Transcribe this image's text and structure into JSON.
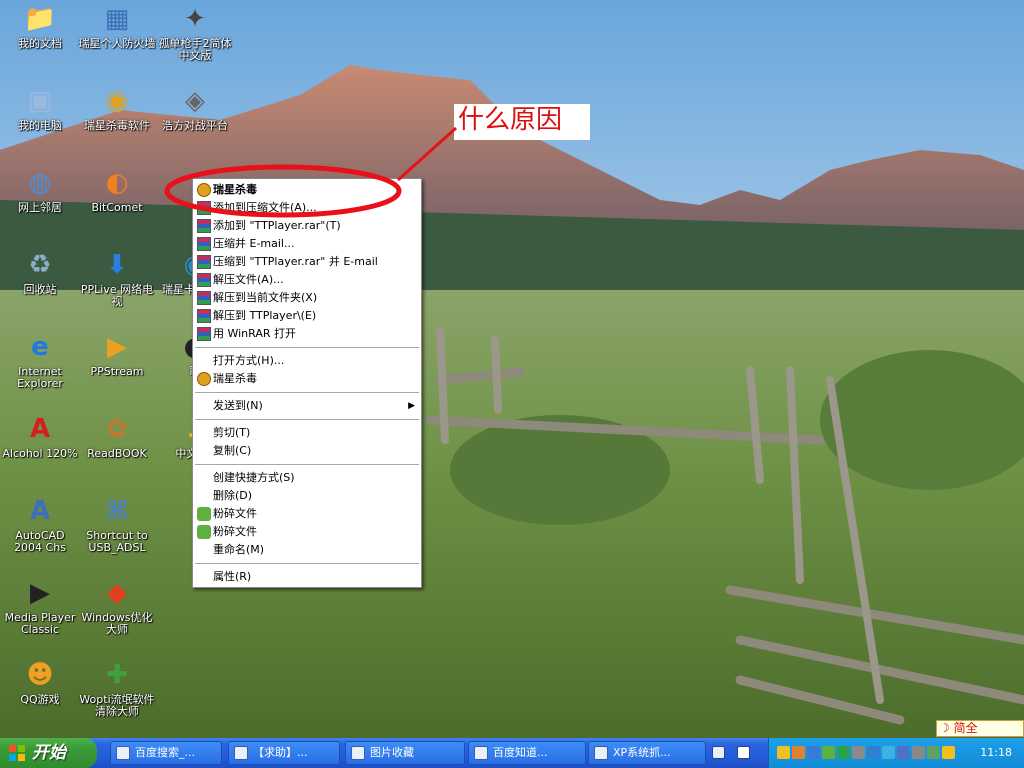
{
  "desktop": {
    "icons": [
      {
        "label": "我的文档",
        "icon": "folder-documents-icon"
      },
      {
        "label": "瑞星个人防火墙",
        "icon": "firewall-icon"
      },
      {
        "label": "孤单枪手2简体中文版",
        "icon": "game-gun-icon"
      },
      {
        "label": "我的电脑",
        "icon": "my-computer-icon"
      },
      {
        "label": "瑞星杀毒软件",
        "icon": "rising-antivirus-icon"
      },
      {
        "label": "浩方对战平台",
        "icon": "game-platform-icon"
      },
      {
        "label": "网上邻居",
        "icon": "network-icon"
      },
      {
        "label": "BitComet",
        "icon": "bitcomet-icon"
      },
      {
        "label": "回收站",
        "icon": "recycle-bin-icon"
      },
      {
        "label": "PPLive 网络电视",
        "icon": "pplive-icon"
      },
      {
        "label": "瑞星卡卡安全",
        "icon": "rising-kaka-icon"
      },
      {
        "label": "Internet Explorer",
        "icon": "internet-explorer-icon"
      },
      {
        "label": "PPStream",
        "icon": "ppstream-icon"
      },
      {
        "label": "聊",
        "icon": "qq-penguin-icon"
      },
      {
        "label": "Alcohol 120%",
        "icon": "alcohol-icon"
      },
      {
        "label": "ReadBOOK",
        "icon": "readbook-icon"
      },
      {
        "label": "中文F歌",
        "icon": "music-icon"
      },
      {
        "label": "AutoCAD 2004 Chs",
        "icon": "autocad-icon"
      },
      {
        "label": "Shortcut to USB_ADSL",
        "icon": "usb-adsl-icon"
      },
      {
        "label": "Media Player Classic",
        "icon": "media-player-icon"
      },
      {
        "label": "Windows优化大师",
        "icon": "windows-optimizer-icon"
      },
      {
        "label": "QQ游戏",
        "icon": "qq-game-icon"
      },
      {
        "label": "Wopti流氓软件清除大师",
        "icon": "wopti-icon"
      }
    ]
  },
  "annotation": {
    "text": "什么原因"
  },
  "context_menu": {
    "items": [
      {
        "label": "瑞星杀毒",
        "icon": "rising-icon",
        "bold": true
      },
      {
        "label": "添加到压缩文件(A)...",
        "icon": "winrar-icon"
      },
      {
        "label": "添加到 \"TTPlayer.rar\"(T)",
        "icon": "winrar-icon"
      },
      {
        "label": "压缩并 E-mail...",
        "icon": "winrar-icon"
      },
      {
        "label": "压缩到 \"TTPlayer.rar\" 并 E-mail",
        "icon": "winrar-icon"
      },
      {
        "label": "解压文件(A)...",
        "icon": "winrar-icon"
      },
      {
        "label": "解压到当前文件夹(X)",
        "icon": "winrar-icon"
      },
      {
        "label": "解压到 TTPlayer\\(E)",
        "icon": "winrar-icon"
      },
      {
        "label": "用 WinRAR 打开",
        "icon": "winrar-icon"
      },
      {
        "sep": true
      },
      {
        "label": "打开方式(H)..."
      },
      {
        "label": "瑞星杀毒",
        "icon": "rising-icon"
      },
      {
        "sep": true
      },
      {
        "label": "发送到(N)",
        "submenu": true
      },
      {
        "sep": true
      },
      {
        "label": "剪切(T)"
      },
      {
        "label": "复制(C)"
      },
      {
        "sep": true
      },
      {
        "label": "创建快捷方式(S)"
      },
      {
        "label": "删除(D)"
      },
      {
        "label": "粉碎文件",
        "icon": "shred-icon"
      },
      {
        "label": "粉碎文件",
        "icon": "shred-icon"
      },
      {
        "label": "重命名(M)"
      },
      {
        "sep": true
      },
      {
        "label": "属性(R)"
      }
    ]
  },
  "taskbar": {
    "start_label": "开始",
    "tasks": [
      {
        "label": "百度搜索_..."
      },
      {
        "label": "【求助】..."
      },
      {
        "label": "图片收藏"
      },
      {
        "label": "百度知道..."
      },
      {
        "label": "XP系统抓..."
      }
    ],
    "clock": "11:18"
  },
  "ime_bar": {
    "text": "简全"
  },
  "colors": {
    "annotation_red": "#d81010",
    "taskbar_blue": "#245ddb",
    "start_green": "#389a35"
  }
}
